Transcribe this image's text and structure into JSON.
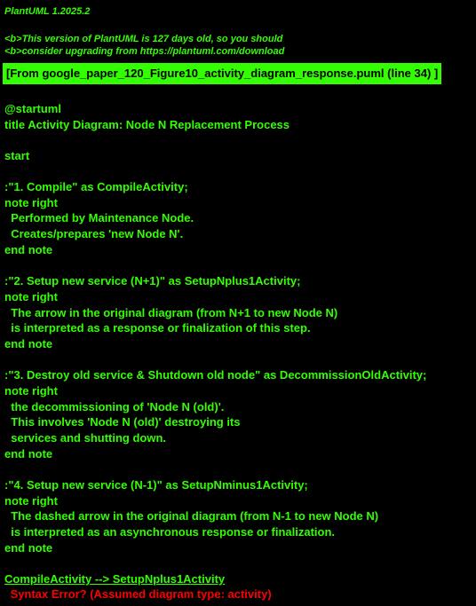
{
  "header": {
    "version": "PlantUML 1.2025.2",
    "warning_line1": "<b>This version of PlantUML is 127 days old, so you should",
    "warning_line2": "<b>consider upgrading from https://plantuml.com/download",
    "file_ref": "[From google_paper_120_Figure10_activity_diagram_response.puml (line 34) ]"
  },
  "source": {
    "lines": [
      "@startuml",
      "title Activity Diagram: Node N Replacement Process",
      "",
      "start",
      "",
      ":\"1. Compile\" as CompileActivity;",
      "note right",
      "  Performed by Maintenance Node.",
      "  Creates/prepares 'new Node N'.",
      "end note",
      "",
      ":\"2. Setup new service (N+1)\" as SetupNplus1Activity;",
      "note right",
      "  The arrow in the original diagram (from N+1 to new Node N)",
      "  is interpreted as a response or finalization of this step.",
      "end note",
      "",
      ":\"3. Destroy old service & Shutdown old node\" as DecommissionOldActivity;",
      "note right",
      "  the decommissioning of 'Node N (old)'.",
      "  This involves 'Node N (old)' destroying its",
      "  services and shutting down.",
      "end note",
      "",
      ":\"4. Setup new service (N-1)\" as SetupNminus1Activity;",
      "note right",
      "  The dashed arrow in the original diagram (from N-1 to new Node N)",
      "  is interpreted as an asynchronous response or finalization.",
      "end note",
      "",
      "CompileActivity --> SetupNplus1Activity"
    ]
  },
  "error": {
    "message": " Syntax Error? (Assumed diagram type: activity)"
  },
  "colors": {
    "background": "#000000",
    "text": "#33ff02",
    "error": "#ff0000"
  }
}
